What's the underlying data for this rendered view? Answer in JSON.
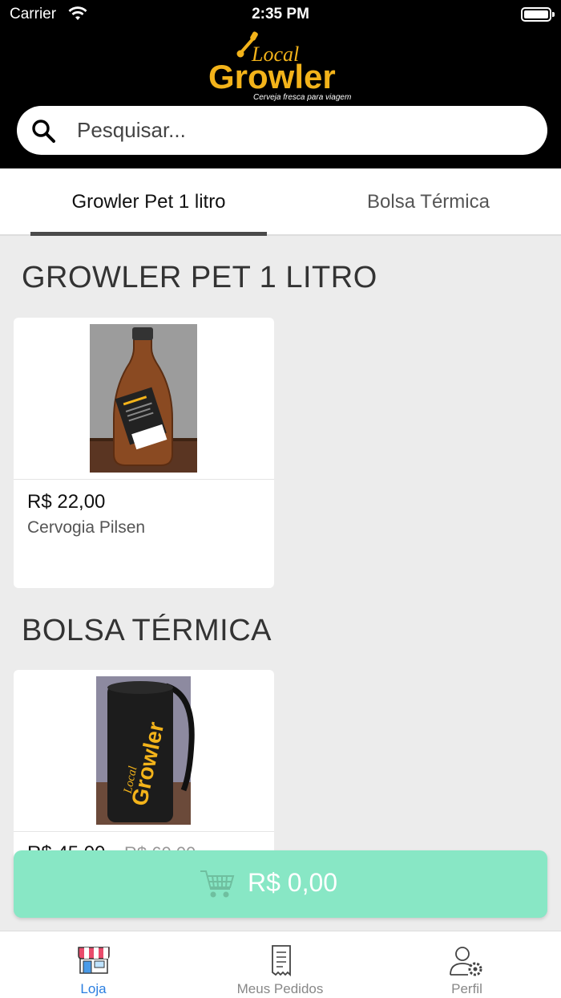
{
  "status_bar": {
    "carrier": "Carrier",
    "time": "2:35 PM"
  },
  "logo": {
    "local": "Local",
    "growler": "Growler",
    "tagline": "Cerveja fresca para viagem"
  },
  "search": {
    "placeholder": "Pesquisar..."
  },
  "tabs": [
    {
      "label": "Growler Pet 1 litro",
      "active": true
    },
    {
      "label": "Bolsa Térmica",
      "active": false
    }
  ],
  "sections": [
    {
      "title": "GROWLER PET 1 LITRO",
      "products": [
        {
          "price": "R$ 22,00",
          "name": "Cervogia Pilsen"
        }
      ]
    },
    {
      "title": "BOLSA TÉRMICA",
      "products": [
        {
          "price": "R$ 45,00",
          "old_price": "R$ 60,00",
          "name": ""
        }
      ]
    }
  ],
  "cart": {
    "total": "R$ 0,00"
  },
  "tabbar": [
    {
      "label": "Loja",
      "icon": "store-icon",
      "active": true
    },
    {
      "label": "Meus Pedidos",
      "icon": "receipt-icon",
      "active": false
    },
    {
      "label": "Perfil",
      "icon": "user-settings-icon",
      "active": false
    }
  ],
  "colors": {
    "header_bg": "#000000",
    "brand_yellow": "#f3b31a",
    "cart_green": "#88e7c5",
    "active_tab": "#2a7ee0"
  }
}
